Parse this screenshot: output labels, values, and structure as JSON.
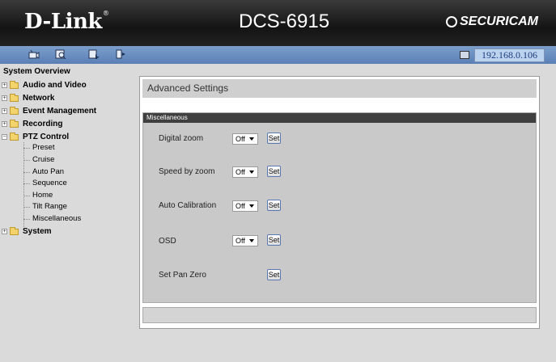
{
  "header": {
    "brand": "D-Link",
    "brand_mark": "®",
    "model": "DCS-6915",
    "product_line": "SECURICAM"
  },
  "toolbar": {
    "icons": [
      "live-video-icon",
      "setup-icon",
      "maintenance-icon",
      "logout-icon"
    ],
    "ip_address": "192.168.0.106"
  },
  "sidebar": {
    "title": "System Overview",
    "items": [
      {
        "label": "Audio and Video",
        "expanded": false
      },
      {
        "label": "Network",
        "expanded": false
      },
      {
        "label": "Event Management",
        "expanded": false
      },
      {
        "label": "Recording",
        "expanded": false
      },
      {
        "label": "PTZ Control",
        "expanded": true
      },
      {
        "label": "System",
        "expanded": false
      }
    ],
    "ptz_sub": [
      "Preset",
      "Cruise",
      "Auto Pan",
      "Sequence",
      "Home",
      "Tilt Range",
      "Miscellaneous"
    ]
  },
  "main": {
    "title": "Advanced Settings",
    "section_title": "Miscellaneous",
    "rows": [
      {
        "label": "Digital zoom",
        "value": "Off",
        "button": "Set"
      },
      {
        "label": "Speed by zoom",
        "value": "Off",
        "button": "Set"
      },
      {
        "label": "Auto Calibration",
        "value": "Off",
        "button": "Set"
      },
      {
        "label": "OSD",
        "value": "Off",
        "button": "Set"
      },
      {
        "label": "Set Pan Zero",
        "button": "Set"
      }
    ]
  },
  "colors": {
    "header_bg": "#1c1c1c",
    "toolbar_bg": "#6a8dbf",
    "section_header": "#3f3f3f",
    "page_bg": "#dadada"
  }
}
